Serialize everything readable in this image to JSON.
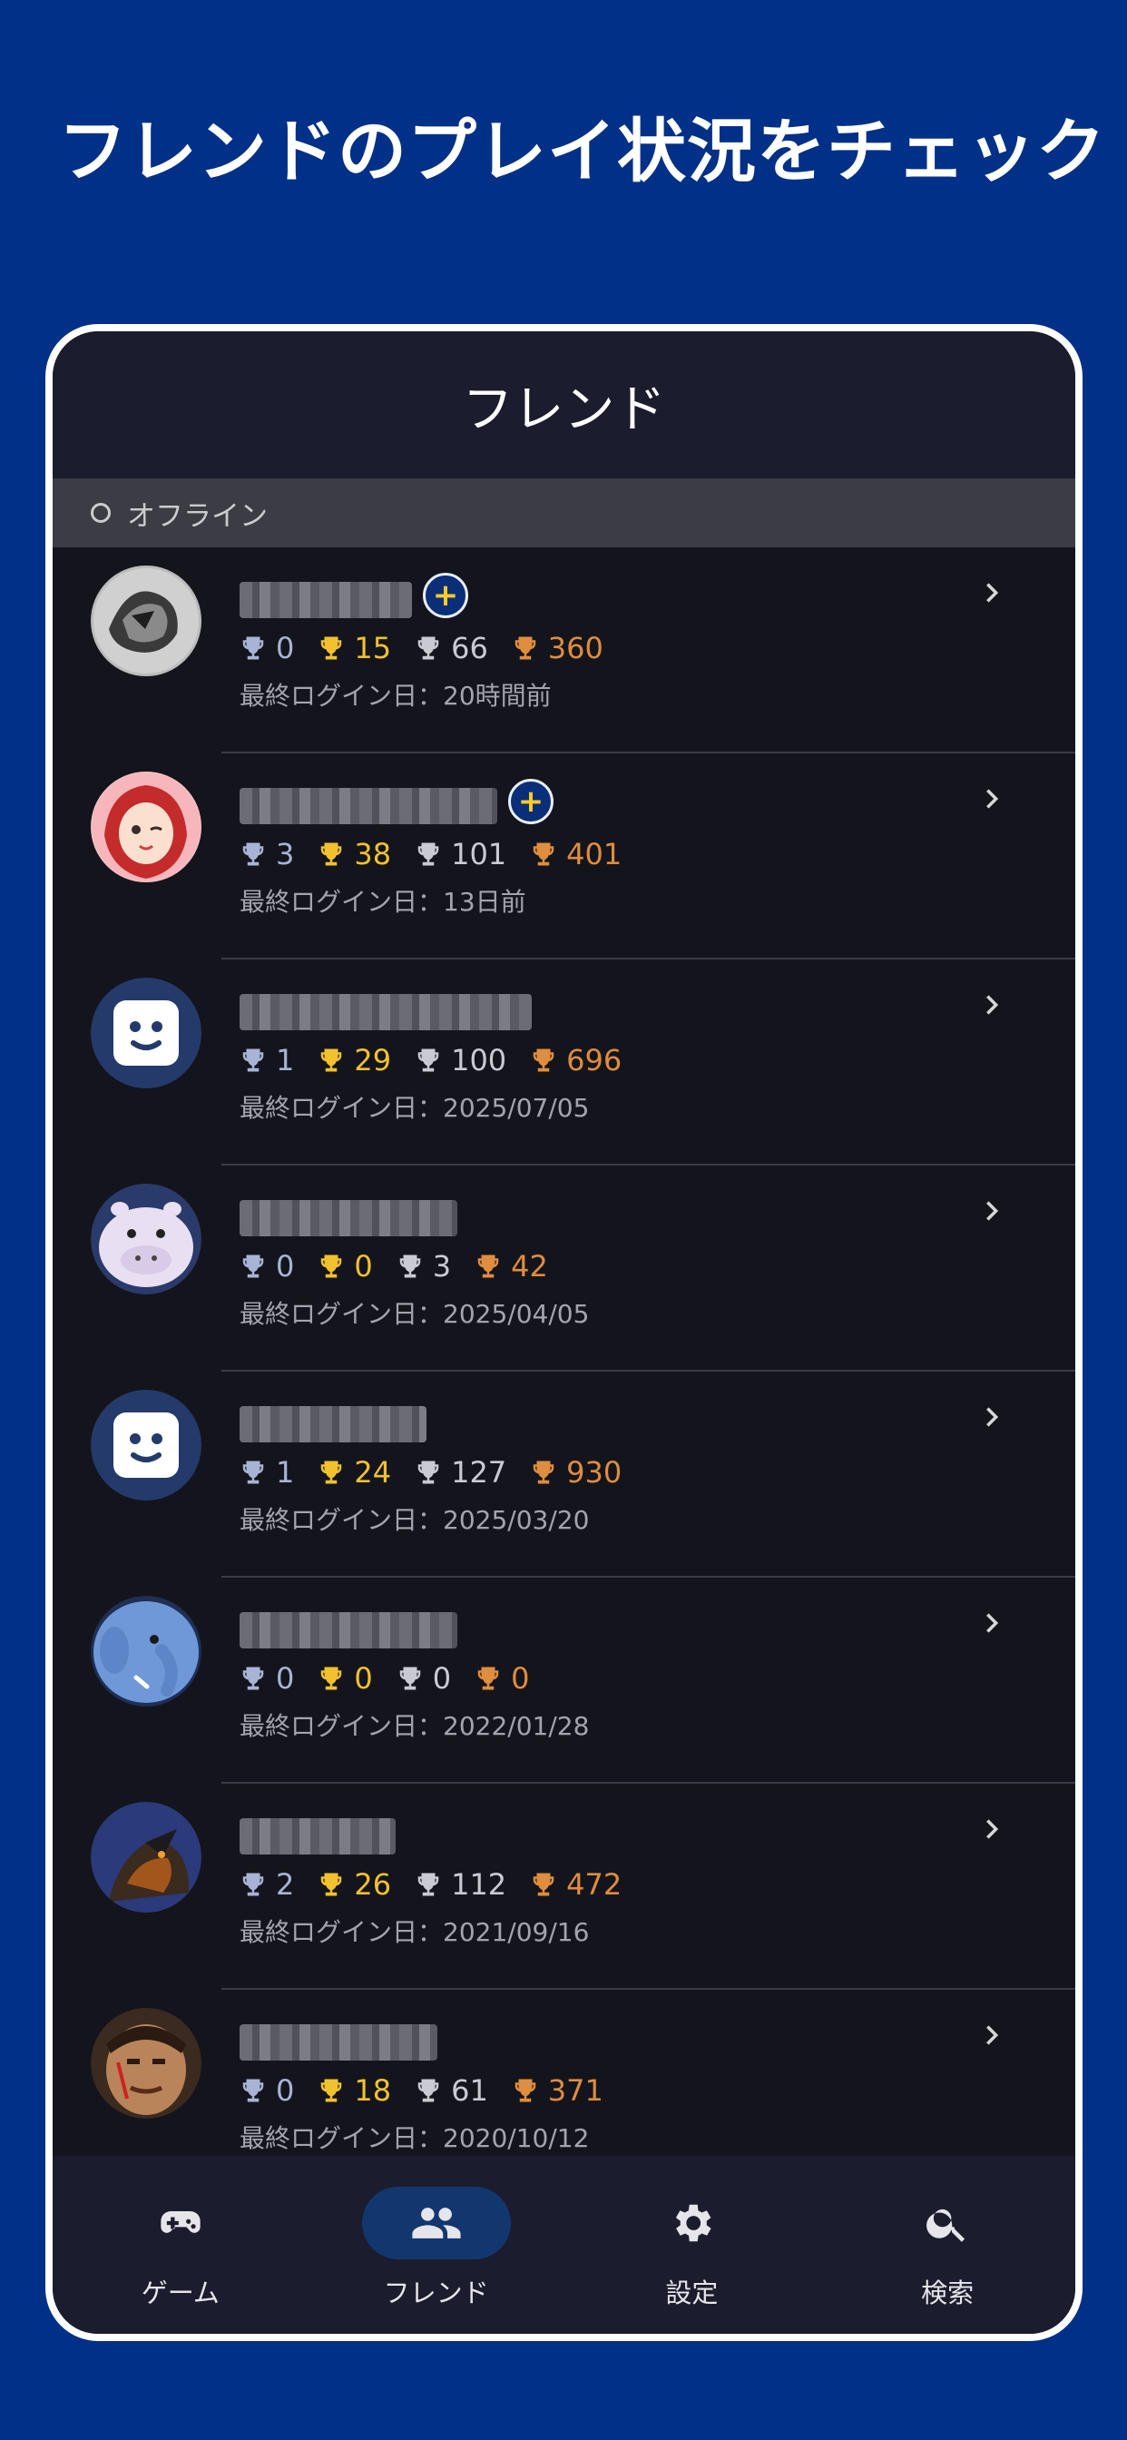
{
  "promo_title": "フレンドのプレイ状況をチェック",
  "screen": {
    "title": "フレンド",
    "section_label": "オフライン"
  },
  "colors": {
    "background": "#003087",
    "platinum": "#a8b4d6",
    "gold": "#f2c12e",
    "silver": "#c9cad2",
    "bronze": "#df8d3e",
    "active_tab": "#12376f"
  },
  "friends": [
    {
      "avatar": "dragon-sketch",
      "plus": true,
      "trophies": {
        "platinum": "0",
        "gold": "15",
        "silver": "66",
        "bronze": "360"
      },
      "last_login": "最終ログイン日：20時間前"
    },
    {
      "avatar": "anime-girl",
      "plus": true,
      "trophies": {
        "platinum": "3",
        "gold": "38",
        "silver": "101",
        "bronze": "401"
      },
      "last_login": "最終ログイン日：13日前"
    },
    {
      "avatar": "default-face",
      "plus": false,
      "trophies": {
        "platinum": "1",
        "gold": "29",
        "silver": "100",
        "bronze": "696"
      },
      "last_login": "最終ログイン日：2025/07/05"
    },
    {
      "avatar": "hippo",
      "plus": false,
      "trophies": {
        "platinum": "0",
        "gold": "0",
        "silver": "3",
        "bronze": "42"
      },
      "last_login": "最終ログイン日：2025/04/05"
    },
    {
      "avatar": "default-face",
      "plus": false,
      "trophies": {
        "platinum": "1",
        "gold": "24",
        "silver": "127",
        "bronze": "930"
      },
      "last_login": "最終ログイン日：2025/03/20"
    },
    {
      "avatar": "blue-elephant",
      "plus": false,
      "trophies": {
        "platinum": "0",
        "gold": "0",
        "silver": "0",
        "bronze": "0"
      },
      "last_login": "最終ログイン日：2022/01/28"
    },
    {
      "avatar": "armored-warrior",
      "plus": false,
      "trophies": {
        "platinum": "2",
        "gold": "26",
        "silver": "112",
        "bronze": "472"
      },
      "last_login": "最終ログイン日：2021/09/16"
    },
    {
      "avatar": "warrior-face",
      "plus": false,
      "trophies": {
        "platinum": "0",
        "gold": "18",
        "silver": "61",
        "bronze": "371"
      },
      "last_login": "最終ログイン日：2020/10/12"
    }
  ],
  "tabs": [
    {
      "label": "ゲーム",
      "icon": "gamepad-icon",
      "active": false
    },
    {
      "label": "フレンド",
      "icon": "people-icon",
      "active": true
    },
    {
      "label": "設定",
      "icon": "gear-icon",
      "active": false
    },
    {
      "label": "検索",
      "icon": "search-icon",
      "active": false
    }
  ]
}
